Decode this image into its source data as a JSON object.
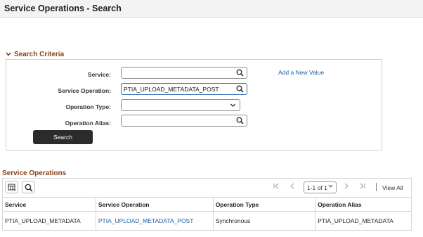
{
  "page": {
    "title": "Service Operations - Search"
  },
  "search_criteria": {
    "title": "Search Criteria",
    "fields": {
      "service": {
        "label": "Service:",
        "value": ""
      },
      "service_operation": {
        "label": "Service Operation:",
        "value": "PTIA_UPLOAD_METADATA_POST"
      },
      "operation_type": {
        "label": "Operation Type:",
        "value": ""
      },
      "operation_alias": {
        "label": "Operation Alias:",
        "value": ""
      }
    },
    "add_new_value": "Add a New Value",
    "search_button": "Search"
  },
  "results": {
    "title": "Service Operations",
    "pager": {
      "range": "1-1 of 1",
      "view_all": "View All"
    },
    "columns": [
      "Service",
      "Service Operation",
      "Operation Type",
      "Operation Alias"
    ],
    "rows": [
      [
        "PTIA_UPLOAD_METADATA",
        "PTIA_UPLOAD_METADATA_POST",
        "Synchronous",
        "PTIA_UPLOAD_METADATA"
      ]
    ]
  },
  "icons": [
    "search-icon",
    "chevron-down-icon",
    "grid-settings-icon",
    "first-page-icon",
    "previous-page-icon",
    "next-page-icon",
    "last-page-icon"
  ],
  "colors": {
    "section_title": "#8a4117",
    "link": "#1c5ea8",
    "button_bg": "#2b2b2b",
    "active_border": "#2d6fb8"
  }
}
